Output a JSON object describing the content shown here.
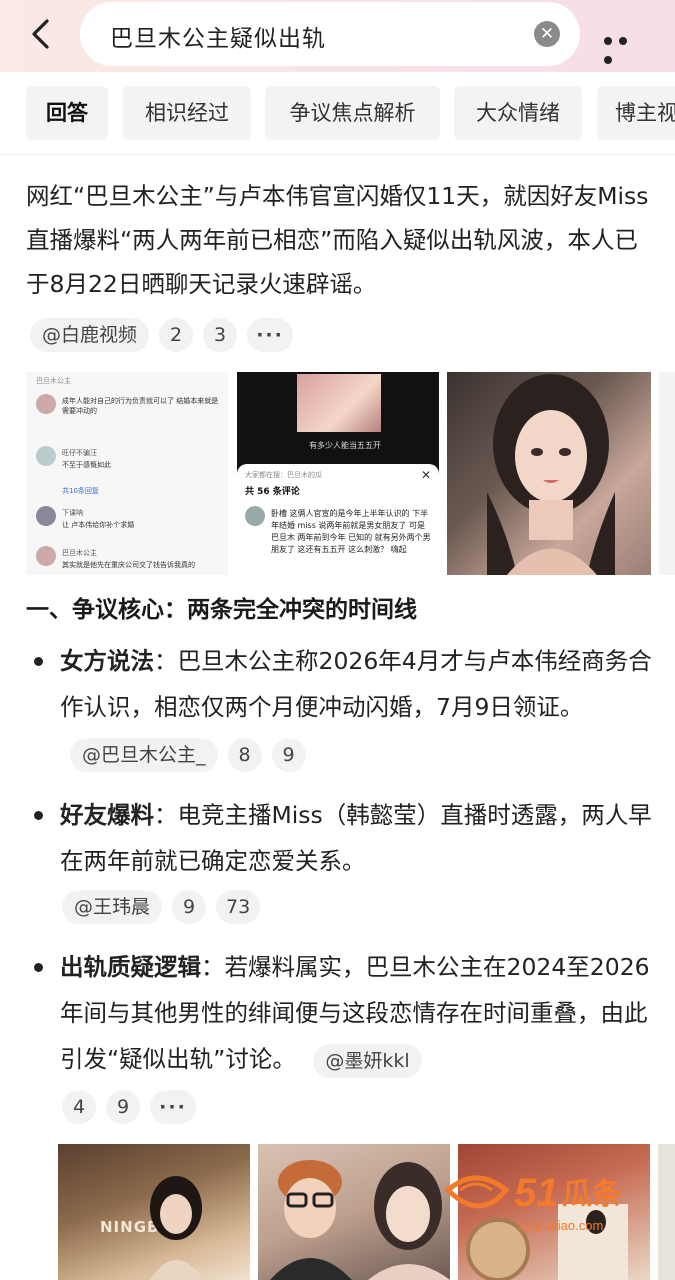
{
  "header": {
    "search_query": "巴旦木公主疑似出轨",
    "clear_icon": "close-icon",
    "back_icon": "chevron-left-icon",
    "more_icon": "more-horizontal-icon"
  },
  "tabs": [
    {
      "label": "回答",
      "active": true
    },
    {
      "label": "相识经过",
      "active": false
    },
    {
      "label": "争议焦点解析",
      "active": false
    },
    {
      "label": "大众情绪",
      "active": false
    },
    {
      "label": "博主视",
      "active": false
    }
  ],
  "answer": {
    "intro": "网红“巴旦木公主”与卢本伟官宣闪婚仅11天，就因好友Miss直播爆料“两人两年前已相恋”而陷入疑似出轨风波，本人已于8月22日晒聊天记录火速辟谣。",
    "intro_source": "@白鹿视频",
    "intro_refs": [
      "2",
      "3"
    ],
    "more_label": "···"
  },
  "image_strip_1": {
    "comment_screenshot": {
      "user1": "巴旦木公主",
      "text1": "成年人能对自己的行为负责就可以了 结婚本来就是需要冲动的",
      "user2": "旺仔不骗汪",
      "text2": "不至于感慨如此",
      "expand": "共10条回复",
      "user3": "下课呐",
      "text3": "让 卢本伟给你补个求婚",
      "user4": "巴旦木公主",
      "text4": "其实就是他先在重庆公司交了钱告诉我真的"
    },
    "video_panel": {
      "caption": "有多少人能当五五开",
      "search_hint": "大家都在搜：巴旦木的瓜",
      "count": "共 56 条评论",
      "comment": "卧槽 这俩人官宣的是今年上半年认识的 下半年结婚 miss 说两年前就是男女朋友了 可是 巴旦木 两年前到今年 已知的 就有另外两个男朋友了 这还有五五开 这么刺激？ 嗨起"
    }
  },
  "section": {
    "title": "一、争议核心：两条完全冲突的时间线",
    "bullets": [
      {
        "label": "女方说法",
        "text": "：巴旦木公主称2026年4月才与卢本伟经商务合作认识，相恋仅两个月便冲动闪婚，7月9日领证。",
        "source": "@巴旦木公主_",
        "refs": [
          "8",
          "9"
        ]
      },
      {
        "label": "好友爆料",
        "text": "：电竞主播Miss（韩懿莹）直播时透露，两人早在两年前就已确定恋爱关系。",
        "source": "@王玮晨",
        "refs": [
          "9",
          "73"
        ]
      },
      {
        "label": "出轨质疑逻辑",
        "text": "：若爆料属实，巴旦木公主在2024至2026年间与其他男性的绯闻便与这段恋情存在时间重叠，由此引发“疑似出轨”讨论。",
        "source": "@墨妍kkl",
        "refs": [
          "4",
          "9"
        ]
      }
    ]
  },
  "image_strip_2": {
    "sign_text": "NINGBO",
    "watermark": "51瓜条",
    "watermark_url": "51guatiao.com"
  },
  "colors": {
    "accent_orange": "#f27a2a",
    "tab_bg": "#f3f3f3",
    "chip_bg": "#f2f2f2"
  }
}
